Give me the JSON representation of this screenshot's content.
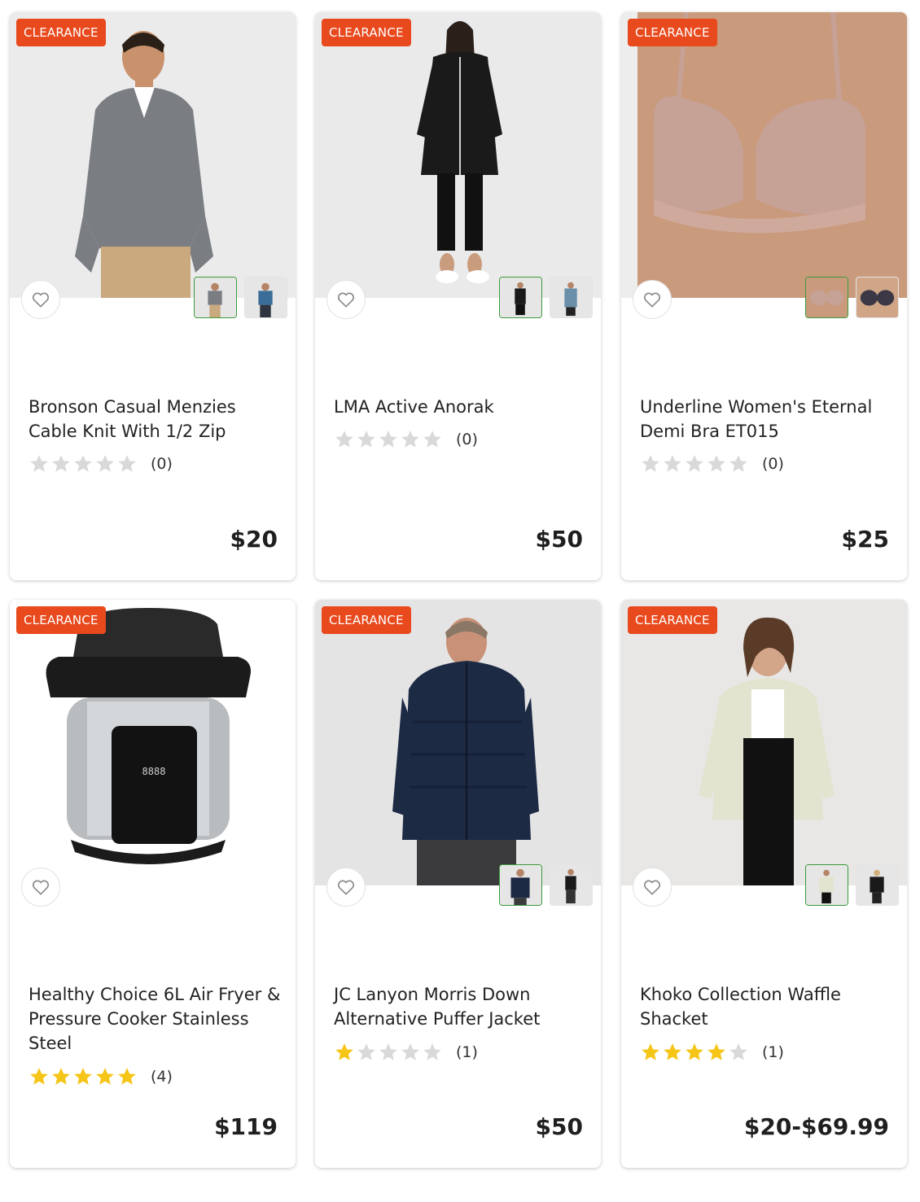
{
  "badge_label": "CLEARANCE",
  "colors": {
    "badge": "#e8491d",
    "star_filled": "#f5c518",
    "star_empty": "#d9d9d9",
    "thumb_selected": "#3a9a3a"
  },
  "products": [
    {
      "title": "Bronson Casual Menzies Cable Knit With 1/2 Zip",
      "rating": 0,
      "count": "(0)",
      "price": "$20",
      "image": "man-grey-sweater",
      "thumbs": 2
    },
    {
      "title": "LMA Active Anorak",
      "rating": 0,
      "count": "(0)",
      "price": "$50",
      "image": "woman-black-anorak",
      "thumbs": 2
    },
    {
      "title": "Underline Women's Eternal Demi Bra ET015",
      "rating": 0,
      "count": "(0)",
      "price": "$25",
      "image": "bra",
      "thumbs": 2
    },
    {
      "title": "Healthy Choice 6L Air Fryer & Pressure Cooker Stainless Steel",
      "rating": 5,
      "count": "(4)",
      "price": "$119",
      "image": "air-fryer",
      "thumbs": 0
    },
    {
      "title": "JC Lanyon Morris Down Alternative Puffer Jacket",
      "rating": 1,
      "count": "(1)",
      "price": "$50",
      "image": "man-puffer-jacket",
      "thumbs": 2
    },
    {
      "title": "Khoko Collection Waffle Shacket",
      "rating": 4,
      "count": "(1)",
      "price": "$20-$69.99",
      "image": "woman-shacket",
      "thumbs": 2
    }
  ]
}
